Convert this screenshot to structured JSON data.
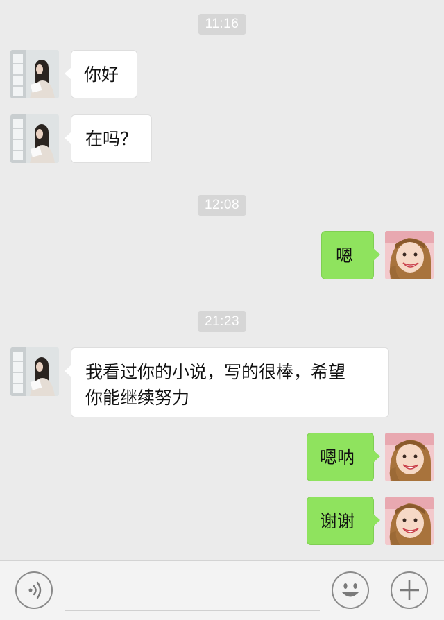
{
  "timestamps": [
    "11:16",
    "12:08",
    "21:23"
  ],
  "messages": [
    {
      "side": "left",
      "text": "你好"
    },
    {
      "side": "left",
      "text": "在吗？"
    },
    {
      "side": "right",
      "text": "嗯"
    },
    {
      "side": "left",
      "text_line1": "我看过你的小说，写的很棒，希望",
      "text_line2": "你能继续努力"
    },
    {
      "side": "right",
      "text": "嗯呐"
    },
    {
      "side": "right",
      "text": "谢谢"
    }
  ],
  "input_bar": {
    "voice_icon": "voice-icon",
    "emoji_icon": "emoji-icon",
    "plus_icon": "plus-icon"
  },
  "colors": {
    "background": "#ebebeb",
    "sent_bubble": "#8fe35e",
    "received_bubble": "#ffffff",
    "timestamp_bg": "#d6d6d6"
  }
}
